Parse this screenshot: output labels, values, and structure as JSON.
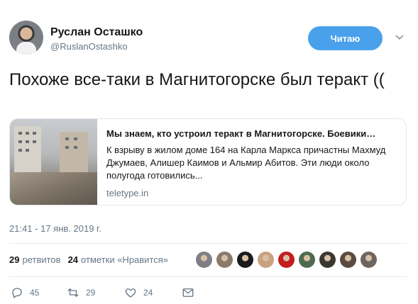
{
  "author": {
    "name": "Руслан Осташко",
    "handle": "@RuslanOstashko"
  },
  "follow_button": "Читаю",
  "tweet_text": "Похоже все-таки в Магнитогорске был теракт ((",
  "card": {
    "title": "Мы знаем, кто устроил теракт в Магнитогорске. Боевики…",
    "description": "К взрыву в жилом доме 164 на Карла Маркса причастны Махмуд Джумаев, Алишер Каимов и Альмир Абитов. Эти люди около полугода готовились...",
    "domain": "teletype.in"
  },
  "timestamp": "21:41 - 17 янв. 2019 г.",
  "stats": {
    "retweets_count": "29",
    "retweets_label": "ретвитов",
    "likes_count": "24",
    "likes_label": "отметки «Нравится»"
  },
  "likers": [
    {
      "color": "#7d7f85"
    },
    {
      "color": "#8a7a6a"
    },
    {
      "color": "#1b1b1b"
    },
    {
      "color": "#c9a27f"
    },
    {
      "color": "#c41d1d"
    },
    {
      "color": "#4f6b4e"
    },
    {
      "color": "#3a3630"
    },
    {
      "color": "#5a4b3e"
    },
    {
      "color": "#6e655e"
    }
  ],
  "actions": {
    "reply_count": "45",
    "retweet_count": "29",
    "like_count": "24"
  },
  "colors": {
    "accent": "#4aa1eb",
    "secondary_text": "#657786",
    "border": "#e1e8ed"
  }
}
